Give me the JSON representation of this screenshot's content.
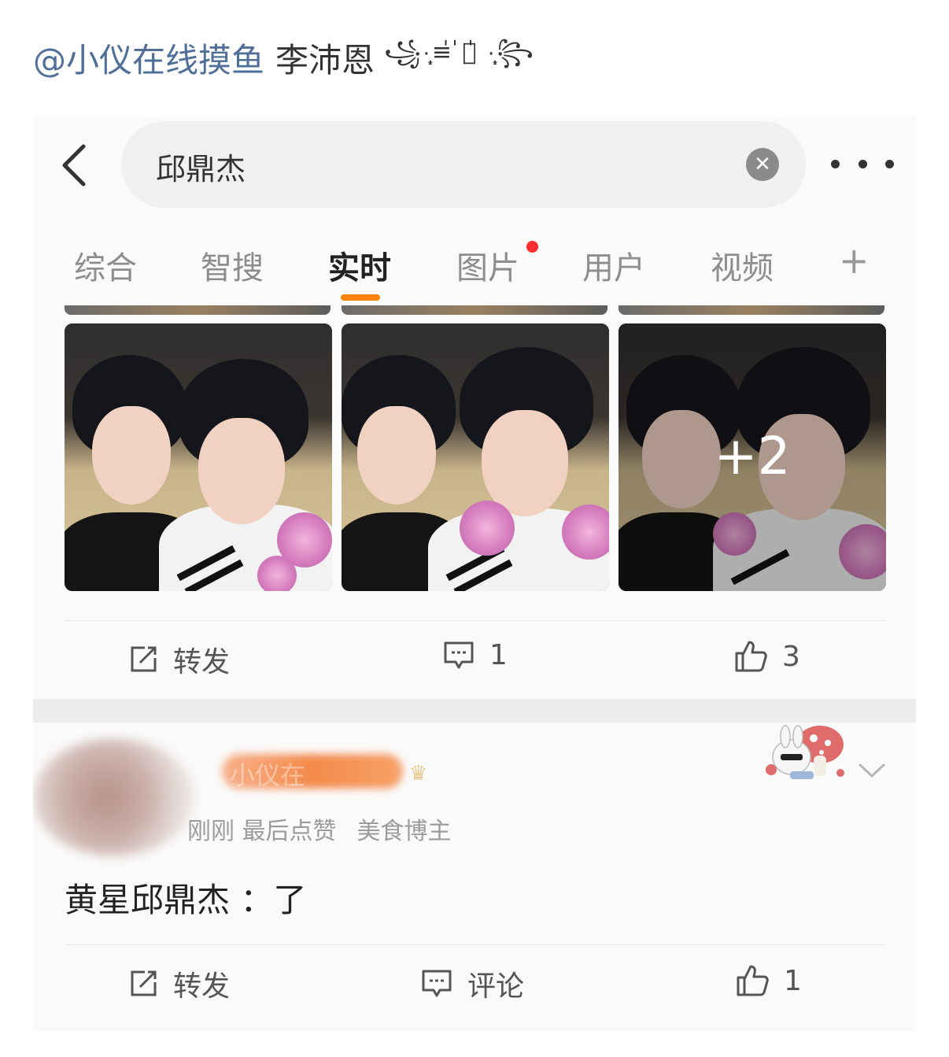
{
  "caption": {
    "mention": "@小仪在线摸鱼",
    "text": "李沛恩",
    "decoration": "꧁·̩͙≡̍ ̍了̍ ·̩͙꧂"
  },
  "search": {
    "query": "邱鼎杰",
    "clear_icon": "close-circle-icon",
    "back_icon": "chevron-left-icon",
    "more_icon": "more-horizontal-icon"
  },
  "tabs": [
    {
      "label": "综合",
      "active": false
    },
    {
      "label": "智搜",
      "active": false
    },
    {
      "label": "实时",
      "active": true
    },
    {
      "label": "图片",
      "active": false,
      "badge": "red-dot"
    },
    {
      "label": "用户",
      "active": false
    },
    {
      "label": "视频",
      "active": false
    },
    {
      "label": "+",
      "active": false
    }
  ],
  "accent_color": "#ff8200",
  "post1": {
    "images": [
      {
        "alt": "photo-1"
      },
      {
        "alt": "photo-2"
      },
      {
        "alt": "photo-3",
        "overlay_count": "+2"
      }
    ],
    "actions": {
      "repost_label": "转发",
      "comment_count": "1",
      "like_count": "3"
    }
  },
  "post2": {
    "username": "小仪在",
    "meta_time": "刚刚 最后点赞",
    "meta_tag": "美食博主",
    "text": "黄星邱鼎杰 ：了",
    "actions": {
      "repost_label": "转发",
      "comment_label": "评论",
      "like_count": "1"
    }
  }
}
